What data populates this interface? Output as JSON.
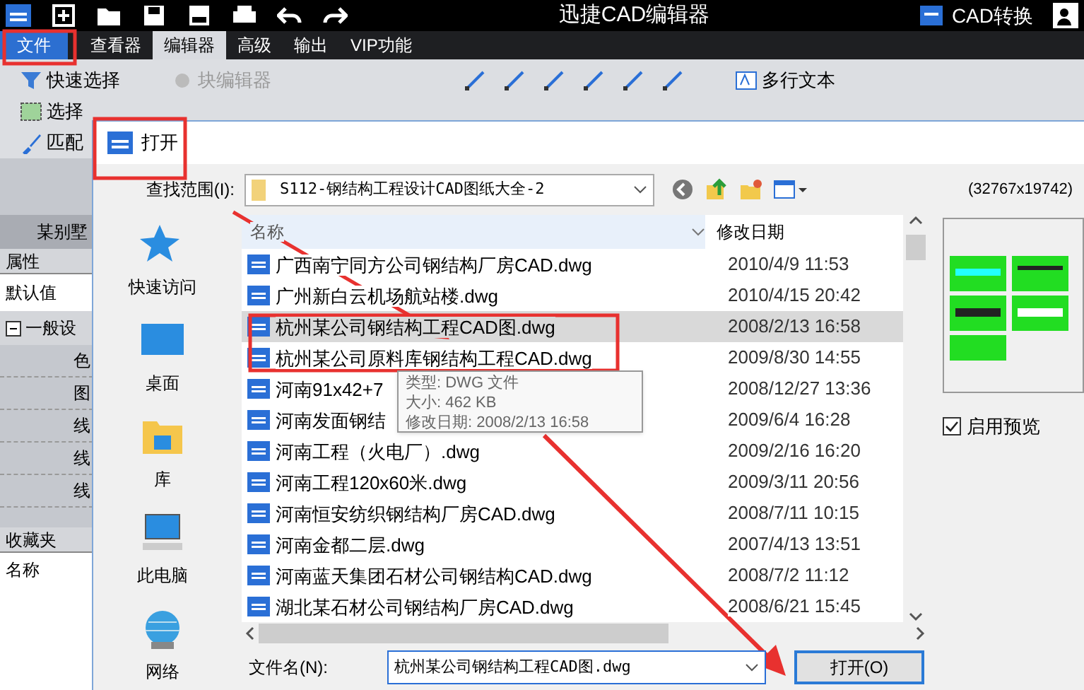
{
  "app": {
    "title": "迅捷CAD编辑器",
    "convert_label": "CAD转换",
    "menu_tabs": [
      {
        "label": "文件",
        "kind": "file",
        "selected": false
      },
      {
        "label": "查看器",
        "kind": "tab",
        "selected": false
      },
      {
        "label": "编辑器",
        "kind": "tab",
        "selected": true
      },
      {
        "label": "高级",
        "kind": "tab",
        "selected": false
      },
      {
        "label": "输出",
        "kind": "tab",
        "selected": false
      },
      {
        "label": "VIP功能",
        "kind": "tab",
        "selected": false
      }
    ],
    "ribbon_rows": [
      [
        {
          "label": "快速选择",
          "kind": "filter",
          "disabled": false
        },
        {
          "label": "块编辑器",
          "kind": "block",
          "disabled": true
        },
        {
          "label": "多行文本",
          "kind": "text",
          "disabled": false
        }
      ],
      [
        {
          "label": "选择",
          "kind": "select",
          "disabled": false
        }
      ],
      [
        {
          "label": "匹配",
          "kind": "brush",
          "disabled": false
        }
      ]
    ],
    "side_panel": {
      "title": "某别墅",
      "properties_header": "属性",
      "default_label": "默认值",
      "group": {
        "label": "一般设",
        "expanded": true,
        "children": [
          "色",
          "图",
          "线",
          "线",
          "线"
        ]
      },
      "favorites_header": "收藏夹",
      "favorites_column": "名称"
    }
  },
  "dialog": {
    "title": "打开",
    "look_in_label": "查找范围(I):",
    "folder": "S112-钢结构工程设计CAD图纸大全-2",
    "dimensions": "(32767x19742)",
    "places": [
      {
        "label": "快速访问",
        "kind": "star"
      },
      {
        "label": "桌面",
        "kind": "desktop"
      },
      {
        "label": "库",
        "kind": "library"
      },
      {
        "label": "此电脑",
        "kind": "computer"
      },
      {
        "label": "网络",
        "kind": "network"
      }
    ],
    "columns": [
      "名称",
      "修改日期"
    ],
    "files": [
      {
        "name": "广西南宁同方公司钢结构厂房CAD.dwg",
        "date": "2010/4/9 11:53",
        "selected": false
      },
      {
        "name": "广州新白云机场航站楼.dwg",
        "date": "2010/4/15 20:42",
        "selected": false
      },
      {
        "name": "杭州某公司钢结构工程CAD图.dwg",
        "date": "2008/2/13 16:58",
        "selected": true
      },
      {
        "name": "杭州某公司原料库钢结构工程CAD.dwg",
        "date": "2009/8/30 14:55",
        "selected": false
      },
      {
        "name": "河南91x42+7",
        "date": "2008/12/27 13:36",
        "selected": false
      },
      {
        "name": "河南发面钢结",
        "date": "2009/6/4 16:28",
        "selected": false
      },
      {
        "name": "河南工程（火电厂）.dwg",
        "date": "2009/2/16 16:20",
        "selected": false
      },
      {
        "name": "河南工程120x60米.dwg",
        "date": "2009/3/11 20:56",
        "selected": false
      },
      {
        "name": "河南恒安纺织钢结构厂房CAD.dwg",
        "date": "2008/7/11 10:15",
        "selected": false
      },
      {
        "name": "河南金都二层.dwg",
        "date": "2007/4/13 13:51",
        "selected": false
      },
      {
        "name": "河南蓝天集团石材公司钢结构CAD.dwg",
        "date": "2008/7/2 11:12",
        "selected": false
      },
      {
        "name": "湖北某石材公司钢结构厂房CAD.dwg",
        "date": "2008/6/21 15:45",
        "selected": false
      }
    ],
    "tooltip": [
      "类型: DWG 文件",
      "大小: 462 KB",
      "修改日期: 2008/2/13 16:58"
    ],
    "preview": {
      "label": "启用预览",
      "checked": true
    },
    "file_name_label": "文件名(N):",
    "file_name": "杭州某公司钢结构工程CAD图.dwg",
    "open_button": "打开(O)"
  }
}
